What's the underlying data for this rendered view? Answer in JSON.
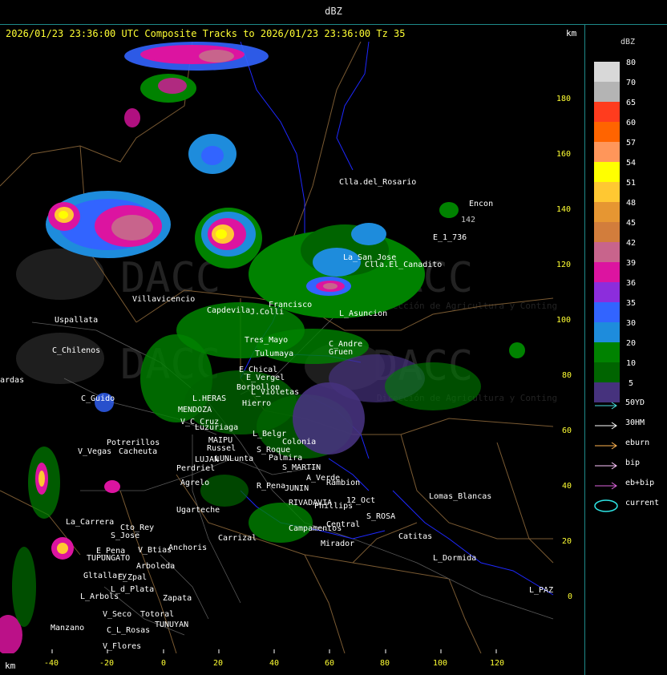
{
  "title": "dBZ",
  "header": "2026/01/23 23:36:00 UTC Composite Tracks to 2026/01/23 23:36:00 Tz 35",
  "axis_unit": "km",
  "x_ticks": [
    "-40",
    "-20",
    "0",
    "20",
    "40",
    "60",
    "80",
    "100",
    "120"
  ],
  "y_ticks": [
    "180",
    "160",
    "140",
    "120",
    "100",
    "80",
    "60",
    "40",
    "20",
    "0"
  ],
  "legend": {
    "title": "dBZ",
    "entries": [
      {
        "label": "80",
        "color": "#d8d8d8"
      },
      {
        "label": "70",
        "color": "#b4b4b4"
      },
      {
        "label": "65",
        "color": "#ff3c1e"
      },
      {
        "label": "60",
        "color": "#ff6400"
      },
      {
        "label": "57",
        "color": "#ff965a"
      },
      {
        "label": "54",
        "color": "#ffff00"
      },
      {
        "label": "51",
        "color": "#ffc832"
      },
      {
        "label": "48",
        "color": "#e69632"
      },
      {
        "label": "45",
        "color": "#d27d3c"
      },
      {
        "label": "42",
        "color": "#c8648c"
      },
      {
        "label": "39",
        "color": "#dc14a0"
      },
      {
        "label": "36",
        "color": "#8c2ddc"
      },
      {
        "label": "35",
        "color": "#3264ff"
      },
      {
        "label": "30",
        "color": "#1e8cdc"
      },
      {
        "label": "20",
        "color": "#008200"
      },
      {
        "label": "10",
        "color": "#006400"
      },
      {
        "label": "5",
        "color": "#46327d"
      }
    ]
  },
  "tracks": [
    {
      "label": "50YD",
      "color": "#46dcdc"
    },
    {
      "label": "30HM",
      "color": "#ffffff"
    },
    {
      "label": "eburn",
      "color": "#ffb450"
    },
    {
      "label": "bip",
      "color": "#ffc8ff"
    },
    {
      "label": "eb+bip",
      "color": "#dc64dc"
    },
    {
      "label": "current",
      "color": "#2ee6e6"
    }
  ],
  "watermarks": [
    "DACC",
    "DACC",
    "DACC",
    "DACC",
    "Dirección de Agricultura y Contingencias Climáticas",
    "Dirección de Agricultura y Contingencias Climáticas"
  ],
  "places": [
    "Clla.del_Rosario",
    "Encon",
    "E_1_736",
    "142",
    "La_San_Jose",
    "Clla.El_Canadito",
    "Villavicencio",
    "Capdevila",
    "J.Colli",
    "Uspallata",
    "Francisco",
    "L_Asuncion",
    "C_Chilenos",
    "Tres_Mayo",
    "C_Andre",
    "Tulumaya",
    "Gruen",
    "E_Chical",
    "E_Vergel",
    "Borbollon",
    "L_Violetas",
    "Hierro",
    "ardas",
    "C_Guido",
    "L.HERAS",
    "MENDOZA",
    "Luzuriaga",
    "V_C_Cruz",
    "MAIPU",
    "Potrerillos",
    "Cacheuta",
    "V_Vegas",
    "Russel",
    "LUJAN",
    "LUNLunta",
    "S_Roque",
    "Palmira",
    "L_Belgr",
    "Colonia",
    "S_MARTIN",
    "Perdriel",
    "Agrelo",
    "Ugarteche",
    "R_Pena",
    "JUNIN",
    "A_Verde",
    "Rambion",
    "RIVADAVIA",
    "Phillips",
    "12_Oct",
    "S_ROSA",
    "Lomas_Blancas",
    "La_Carrera",
    "Cto_Rey",
    "S_Jose",
    "Carrizal",
    "Campamentos",
    "Central",
    "Catitas",
    "E_Pena",
    "TUPUNGATO",
    "V_Btias",
    "Anchoris",
    "Mirador",
    "L_Dormida",
    "Gltallary",
    "E_Zpal",
    "Arboleda",
    "L_Arbols",
    "L_d_Plata",
    "Zapata",
    "L_PAZ",
    "V_Seco",
    "Totoral",
    "TUNUYAN",
    "Manzano",
    "C_L_Rosas",
    "V_Flores"
  ]
}
